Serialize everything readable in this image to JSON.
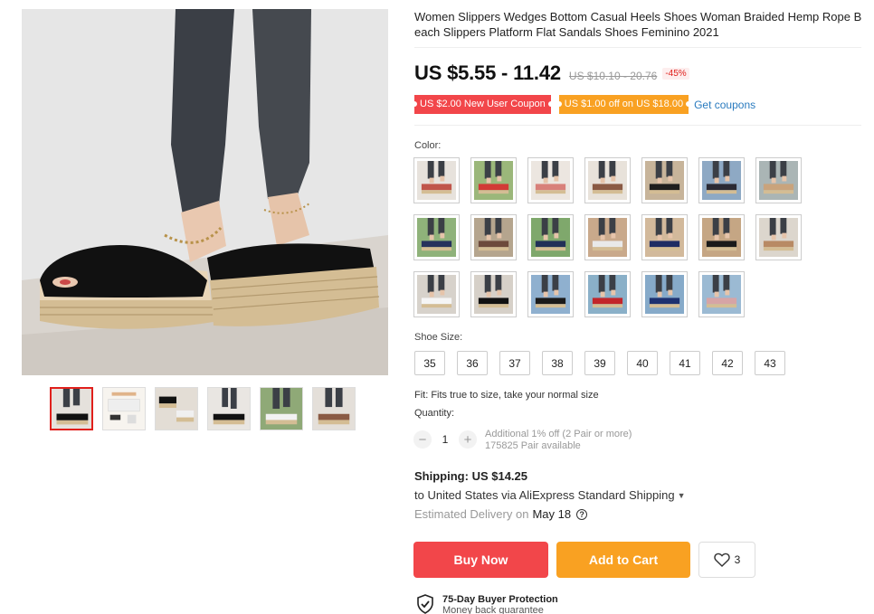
{
  "product": {
    "title_line1": "Women Slippers Wedges Bottom Casual Heels Shoes Woman Braided Hemp Rope B",
    "title_line2": "each Slippers Platform Flat Sandals Shoes Feminino 2021"
  },
  "pricing": {
    "price": "US $5.55 - 11.42",
    "original_price": "US $10.10 - 20.76",
    "discount": "-45%"
  },
  "coupons": {
    "new_user": "US $2.00 New User Coupon",
    "store": "US $1.00 off on US $18.00",
    "get_label": "Get coupons"
  },
  "color": {
    "label": "Color:",
    "swatches": [
      {
        "shoe": "#c0554a",
        "bg": "#e7e2dc"
      },
      {
        "shoe": "#d23a36",
        "bg": "#9bb77a"
      },
      {
        "shoe": "#d8807a",
        "bg": "#ece6e0"
      },
      {
        "shoe": "#8a5a44",
        "bg": "#e8e2da"
      },
      {
        "shoe": "#1e1e1e",
        "bg": "#c7b49a"
      },
      {
        "shoe": "#2a2a34",
        "bg": "#8ea9c4"
      },
      {
        "shoe": "#c9a37c",
        "bg": "#aab5b5"
      },
      {
        "shoe": "#26315c",
        "bg": "#8fb27a"
      },
      {
        "shoe": "#6d4a3c",
        "bg": "#b5a58e"
      },
      {
        "shoe": "#213057",
        "bg": "#7fa86c"
      },
      {
        "shoe": "#e9e9e9",
        "bg": "#c9a98b"
      },
      {
        "shoe": "#1f2d63",
        "bg": "#d2b99b"
      },
      {
        "shoe": "#1a1a1a",
        "bg": "#c5a684"
      },
      {
        "shoe": "#b88a64",
        "bg": "#dcd6cd"
      },
      {
        "shoe": "#f5f5f5",
        "bg": "#d7d2cb"
      },
      {
        "shoe": "#111111",
        "bg": "#d6d0c8"
      },
      {
        "shoe": "#1a1a1a",
        "bg": "#8fb0cf"
      },
      {
        "shoe": "#c2262b",
        "bg": "#8ab0c8"
      },
      {
        "shoe": "#1d3170",
        "bg": "#86aac9"
      },
      {
        "shoe": "#d6a4a6",
        "bg": "#9bbad3"
      }
    ]
  },
  "size": {
    "label": "Shoe Size:",
    "options": [
      "35",
      "36",
      "37",
      "38",
      "39",
      "40",
      "41",
      "42",
      "43"
    ]
  },
  "fit_text": "Fit: Fits true to size, take your normal size",
  "quantity": {
    "label": "Quantity:",
    "minus": "−",
    "value": "1",
    "plus": "+",
    "note": "Additional 1% off (2 Pair or more)",
    "available": "175825 Pair available"
  },
  "shipping": {
    "title": "Shipping:",
    "cost": "US $14.25",
    "route": "to United States via AliExpress Standard Shipping",
    "delivery_label": "Estimated Delivery on",
    "delivery_date": "May 18",
    "help": "?"
  },
  "actions": {
    "buy_now": "Buy Now",
    "add_to_cart": "Add to Cart",
    "wishlist_count": "3"
  },
  "protection": {
    "title": "75-Day Buyer Protection",
    "subtitle": "Money back guarantee"
  },
  "colors": {
    "accent_red": "#f2464a",
    "accent_orange": "#f9a122",
    "link_blue": "#2a7bbf"
  }
}
